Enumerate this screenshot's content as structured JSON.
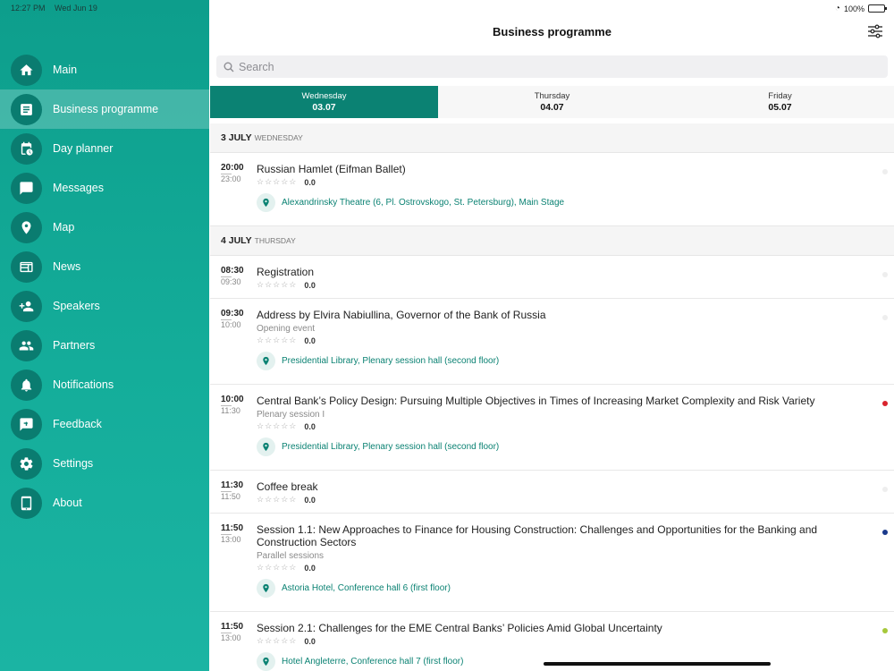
{
  "status": {
    "time": "12:27 PM",
    "date": "Wed Jun 19",
    "battery": "100%"
  },
  "sidebar": {
    "items": [
      {
        "label": "Main",
        "icon": "home-icon"
      },
      {
        "label": "Business programme",
        "icon": "document-icon",
        "active": true
      },
      {
        "label": "Day planner",
        "icon": "calendar-clock-icon"
      },
      {
        "label": "Messages",
        "icon": "chat-icon"
      },
      {
        "label": "Map",
        "icon": "map-pin-icon"
      },
      {
        "label": "News",
        "icon": "news-icon"
      },
      {
        "label": "Speakers",
        "icon": "add-person-icon"
      },
      {
        "label": "Partners",
        "icon": "people-icon"
      },
      {
        "label": "Notifications",
        "icon": "bell-icon"
      },
      {
        "label": "Feedback",
        "icon": "feedback-icon"
      },
      {
        "label": "Settings",
        "icon": "gear-icon"
      },
      {
        "label": "About",
        "icon": "tablet-icon"
      }
    ],
    "accent": "#0b8273"
  },
  "header": {
    "title": "Business programme"
  },
  "search": {
    "placeholder": "Search"
  },
  "tabs": [
    {
      "day": "Wednesday",
      "date": "03.07",
      "active": true
    },
    {
      "day": "Thursday",
      "date": "04.07"
    },
    {
      "day": "Friday",
      "date": "05.07"
    }
  ],
  "days": [
    {
      "main": "3 JULY",
      "sub": "WEDNESDAY"
    },
    {
      "main": "4 JULY",
      "sub": "THURSDAY"
    }
  ],
  "events": [
    {
      "start": "20:00",
      "end": "23:00",
      "title": "Russian Hamlet (Eifman Ballet)",
      "subtitle": "",
      "stars": "☆☆☆☆☆",
      "score": "0.0",
      "location": "Alexandrinsky Theatre (6, Pl. Ostrovskogo, St. Petersburg), Main Stage",
      "dot_color": "#eeeeee"
    },
    {
      "start": "08:30",
      "end": "09:30",
      "title": "Registration",
      "subtitle": "",
      "stars": "☆☆☆☆☆",
      "score": "0.0",
      "location": "",
      "dot_color": "#eeeeee"
    },
    {
      "start": "09:30",
      "end": "10:00",
      "title": "Address by Elvira Nabiullina, Governor of the Bank of Russia",
      "subtitle": "Opening event",
      "stars": "☆☆☆☆☆",
      "score": "0.0",
      "location": "Presidential Library, Plenary session hall (second floor)",
      "dot_color": "#eeeeee"
    },
    {
      "start": "10:00",
      "end": "11:30",
      "title": "Central Bank’s Policy Design: Pursuing Multiple Objectives in Times of Increasing Market Complexity and Risk Variety",
      "subtitle": "Plenary session I",
      "stars": "☆☆☆☆☆",
      "score": "0.0",
      "location": "Presidential Library, Plenary session hall (second floor)",
      "dot_color": "#d9232d"
    },
    {
      "start": "11:30",
      "end": "11:50",
      "title": "Coffee break",
      "subtitle": "",
      "stars": "☆☆☆☆☆",
      "score": "0.0",
      "location": "",
      "dot_color": "#eeeeee"
    },
    {
      "start": "11:50",
      "end": "13:00",
      "title": "Session 1.1: New Approaches to Finance for Housing Construction: Challenges and Opportunities for the Banking and Construction Sectors",
      "subtitle": "Parallel sessions",
      "stars": "☆☆☆☆☆",
      "score": "0.0",
      "location": "Astoria Hotel, Conference hall 6 (first floor)",
      "dot_color": "#1a3a8c"
    },
    {
      "start": "11:50",
      "end": "13:00",
      "title": "Session 2.1: Challenges for the EME Central Banks’ Policies Amid Global Uncertainty",
      "subtitle": "",
      "stars": "☆☆☆☆☆",
      "score": "0.0",
      "location": "Hotel Angleterre, Conference hall 7 (first floor)",
      "dot_color": "#a6c83a"
    }
  ]
}
